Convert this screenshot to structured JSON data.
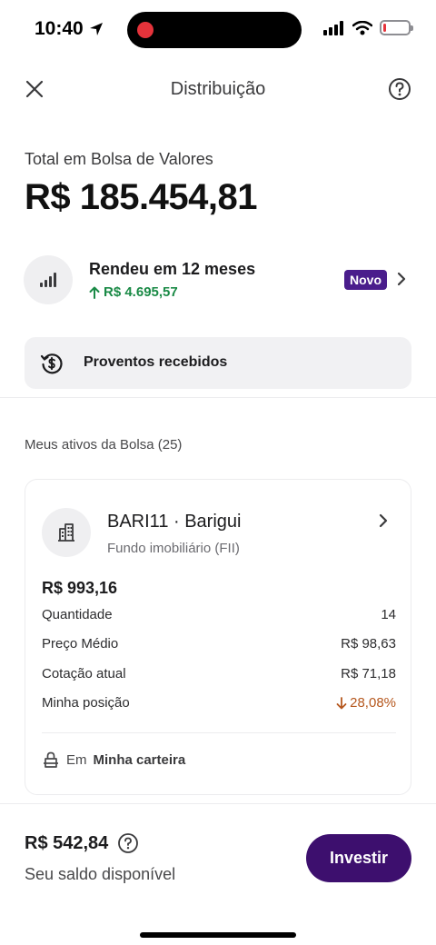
{
  "status_bar": {
    "time": "10:40",
    "battery_level": 0.12,
    "colors": {
      "recording": "#e5333b",
      "battery_low": "#e5333b"
    }
  },
  "header": {
    "title": "Distribuição",
    "close_icon": "close-icon",
    "help_icon": "help-icon"
  },
  "total": {
    "label": "Total em Bolsa de Valores",
    "value": "R$ 185.454,81"
  },
  "yield": {
    "title": "Rendeu em 12 meses",
    "value": "R$ 4.695,57",
    "badge": "Novo",
    "icon": "signal-bars-icon",
    "colors": {
      "positive": "#1a8a46",
      "badge_bg": "#4a1d8c"
    }
  },
  "proventos": {
    "label": "Proventos recebidos",
    "icon": "dollar-history-icon"
  },
  "assets_section": {
    "title": "Meus ativos da Bolsa (25)"
  },
  "asset": {
    "name": "BARI11 · Barigui",
    "type": "Fundo imobiliário (FII)",
    "amount": "R$ 993,16",
    "icon": "building-icon",
    "rows": [
      {
        "label": "Quantidade",
        "value": "14"
      },
      {
        "label": "Preço Médio",
        "value": "R$ 98,63"
      },
      {
        "label": "Cotação atual",
        "value": "R$ 71,18"
      },
      {
        "label": "Minha posição",
        "value": "28,08%"
      }
    ],
    "wallet_prefix": "Em",
    "wallet_name": "Minha carteira",
    "colors": {
      "negative": "#b5571d"
    }
  },
  "bottom": {
    "balance": "R$ 542,84",
    "balance_label": "Seu saldo disponível",
    "invest_label": "Investir",
    "colors": {
      "primary": "#3d0f6e"
    }
  }
}
